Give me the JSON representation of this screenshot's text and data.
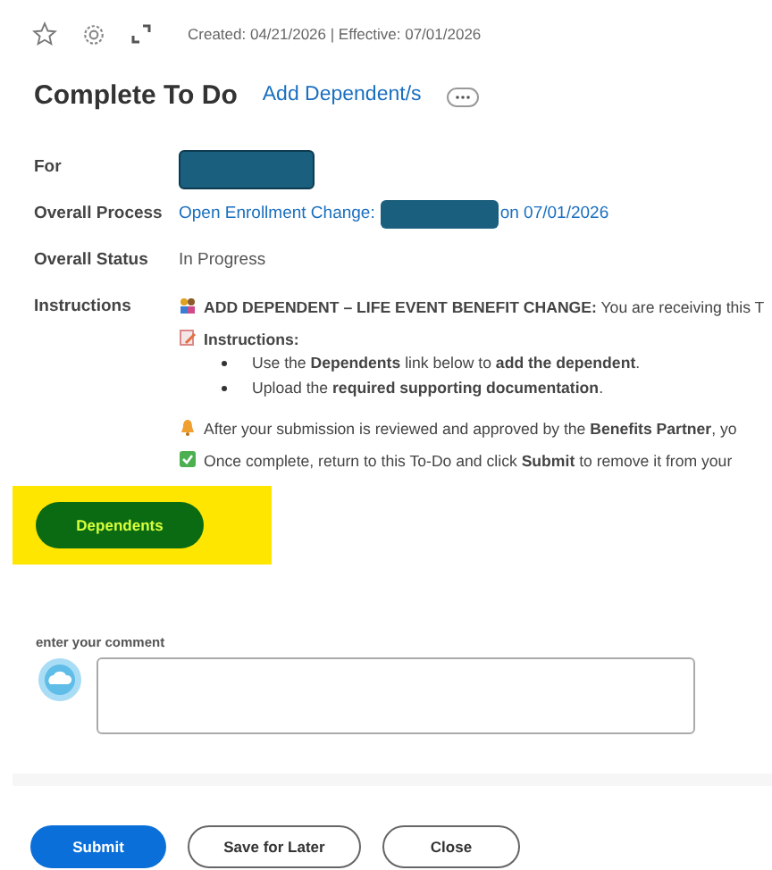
{
  "header": {
    "meta": "Created: 04/21/2026 | Effective: 07/01/2026"
  },
  "title": "Complete To Do",
  "title_link": "Add Dependent/s",
  "fields": [
    {
      "label": "For",
      "kind": "redacted"
    },
    {
      "label": "Overall Process",
      "kind": "process",
      "link": "Open Enrollment Change:",
      "suffix": "on 07/01/2026"
    },
    {
      "label": "Overall Status",
      "kind": "text",
      "value": "In Progress"
    },
    {
      "label": "Instructions",
      "kind": "instructions"
    }
  ],
  "instructions": [
    {
      "kind": "people",
      "text": "**ADD DEPENDENT – LIFE EVENT BENEFIT CHANGE:** You are receiving this T"
    },
    {
      "kind": "memo",
      "text": "**Instructions:**",
      "bullets": [
        "Use the **Dependents** link below to **add the dependent**.",
        "Upload the **required supporting documentation**."
      ]
    },
    {
      "kind": "bell",
      "text": "After your submission is reviewed and approved by the **Benefits Partner**, yo"
    },
    {
      "kind": "check",
      "text": "Once complete, return to this To-Do and click **Submit** to remove it from your"
    }
  ],
  "dependents_button": {
    "label": "Dependents",
    "highlighted": true
  },
  "comment": {
    "label": "enter your comment"
  },
  "buttons": [
    {
      "label": "Submit",
      "kind": "primary"
    },
    {
      "label": "Save for Later",
      "kind": "secondary"
    },
    {
      "label": "Close",
      "kind": "secondary"
    }
  ]
}
